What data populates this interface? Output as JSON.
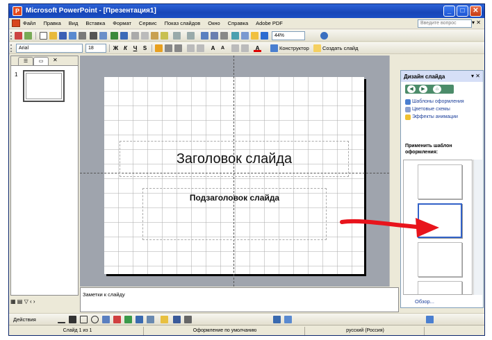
{
  "window": {
    "title": "Microsoft PowerPoint - [Презентация1]",
    "app_icon": "powerpoint-icon",
    "buttons": [
      "minimize",
      "maximize",
      "close"
    ],
    "colors": {
      "titlebar": "#1746b8",
      "close": "#c63a12"
    }
  },
  "menubar": {
    "items": [
      "Файл",
      "Правка",
      "Вид",
      "Вставка",
      "Формат",
      "Сервис",
      "Показ слайдов",
      "Окно",
      "Справка",
      "Adobe PDF"
    ],
    "ask_placeholder": "Введите вопрос"
  },
  "toolbar_format": {
    "font": "Arial",
    "font_size": "18",
    "zoom": "44%",
    "designer_label": "Конструктор",
    "create_slide_label": "Создать слайд"
  },
  "left_pane": {
    "slide_number": "1"
  },
  "slide": {
    "title": "Заголовок слайда",
    "subtitle": "Подзаголовок слайда"
  },
  "notes": {
    "placeholder": "Заметки к слайду"
  },
  "task_pane": {
    "title": "Дизайн слайда",
    "links": [
      "Шаблоны оформления",
      "Цветовые схемы",
      "Эффекты анимации"
    ],
    "apply_label": "Применить шаблон оформления:",
    "templates_count": 4,
    "selected_template": 2,
    "browse_label": "Обзор..."
  },
  "drawbar": {
    "actions_label": "Действия"
  },
  "statusbar": {
    "slide_info": "Слайд 1 из 1",
    "design": "Оформление по умолчанию",
    "language": "русский (Россия)"
  },
  "annotation": {
    "arrow_color": "#e8141c",
    "arrow_icon": "red-arrow"
  }
}
